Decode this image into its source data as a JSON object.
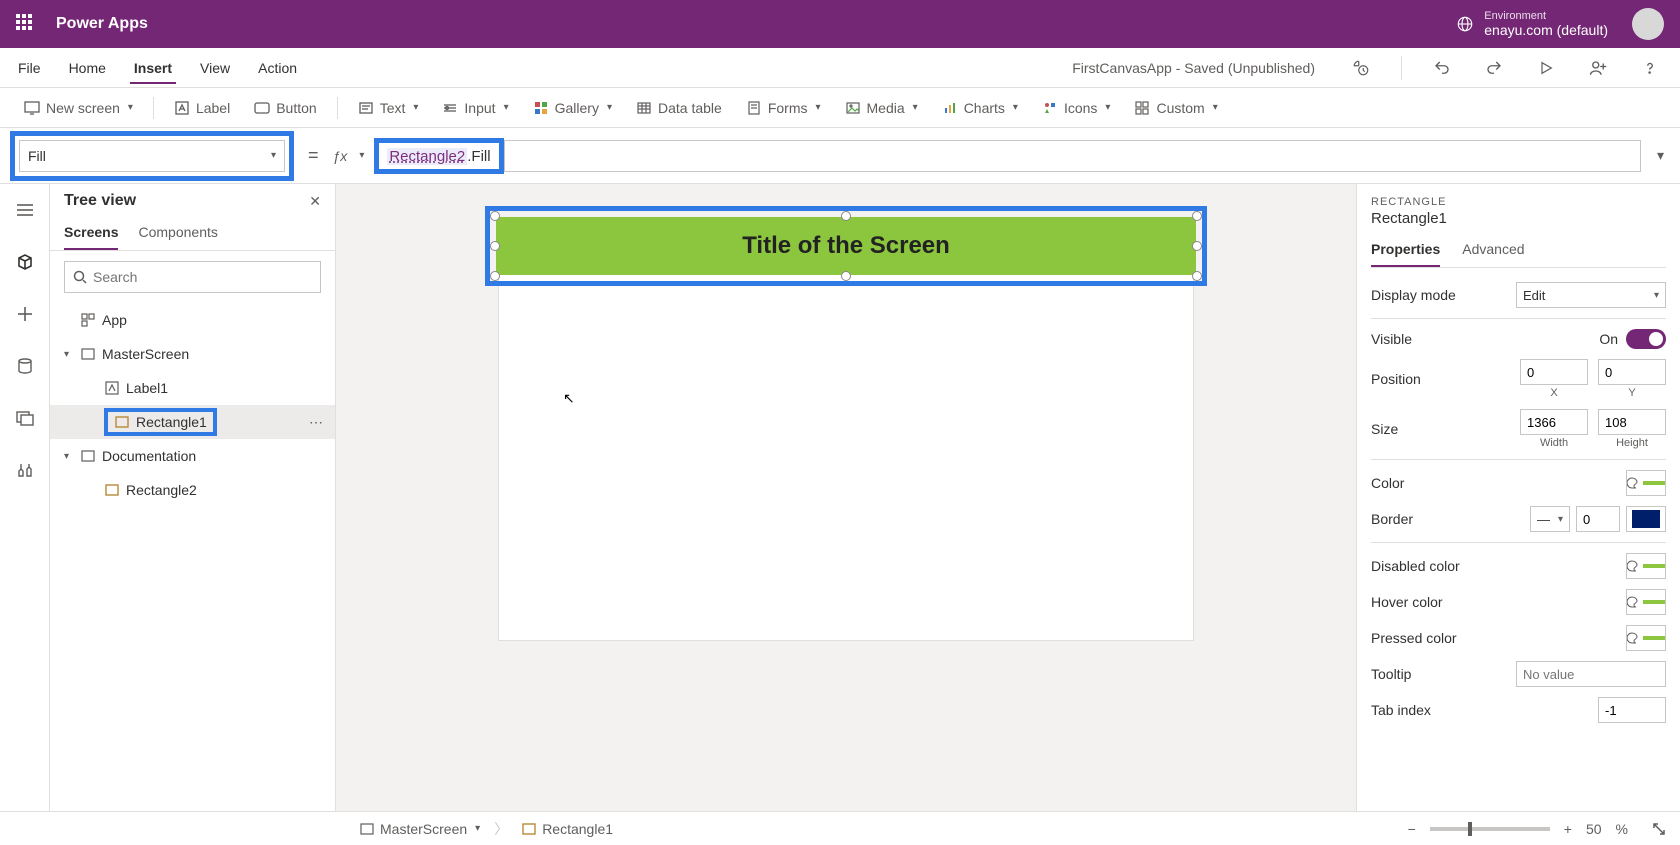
{
  "header": {
    "app_title": "Power Apps",
    "env_label": "Environment",
    "env_name": "enayu.com (default)"
  },
  "menubar": {
    "items": [
      "File",
      "Home",
      "Insert",
      "View",
      "Action"
    ],
    "active": "Insert",
    "doc_status": "FirstCanvasApp - Saved (Unpublished)"
  },
  "ribbon": {
    "new_screen": "New screen",
    "label": "Label",
    "button": "Button",
    "text": "Text",
    "input": "Input",
    "gallery": "Gallery",
    "data_table": "Data table",
    "forms": "Forms",
    "media": "Media",
    "charts": "Charts",
    "icons": "Icons",
    "custom": "Custom"
  },
  "formula_bar": {
    "property": "Fill",
    "formula_ref": "Rectangle2",
    "formula_rest": ".Fill"
  },
  "tree": {
    "title": "Tree view",
    "tabs": [
      "Screens",
      "Components"
    ],
    "active_tab": "Screens",
    "search_placeholder": "Search",
    "items": {
      "app": "App",
      "master": "MasterScreen",
      "label1": "Label1",
      "rect1": "Rectangle1",
      "documentation": "Documentation",
      "rect2": "Rectangle2"
    }
  },
  "canvas": {
    "title_text": "Title of the Screen"
  },
  "props": {
    "type": "RECTANGLE",
    "name": "Rectangle1",
    "tabs": [
      "Properties",
      "Advanced"
    ],
    "active_tab": "Properties",
    "display_mode_label": "Display mode",
    "display_mode_value": "Edit",
    "visible_label": "Visible",
    "visible_value": "On",
    "position_label": "Position",
    "pos_x": "0",
    "pos_y": "0",
    "pos_x_lbl": "X",
    "pos_y_lbl": "Y",
    "size_label": "Size",
    "width": "1366",
    "height": "108",
    "width_lbl": "Width",
    "height_lbl": "Height",
    "color_label": "Color",
    "border_label": "Border",
    "border_width": "0",
    "disabled_label": "Disabled color",
    "hover_label": "Hover color",
    "pressed_label": "Pressed color",
    "tooltip_label": "Tooltip",
    "tooltip_placeholder": "No value",
    "tabindex_label": "Tab index",
    "tabindex_value": "-1"
  },
  "bottom": {
    "screen": "MasterScreen",
    "selected": "Rectangle1",
    "zoom": "50",
    "zoom_unit": "%"
  }
}
